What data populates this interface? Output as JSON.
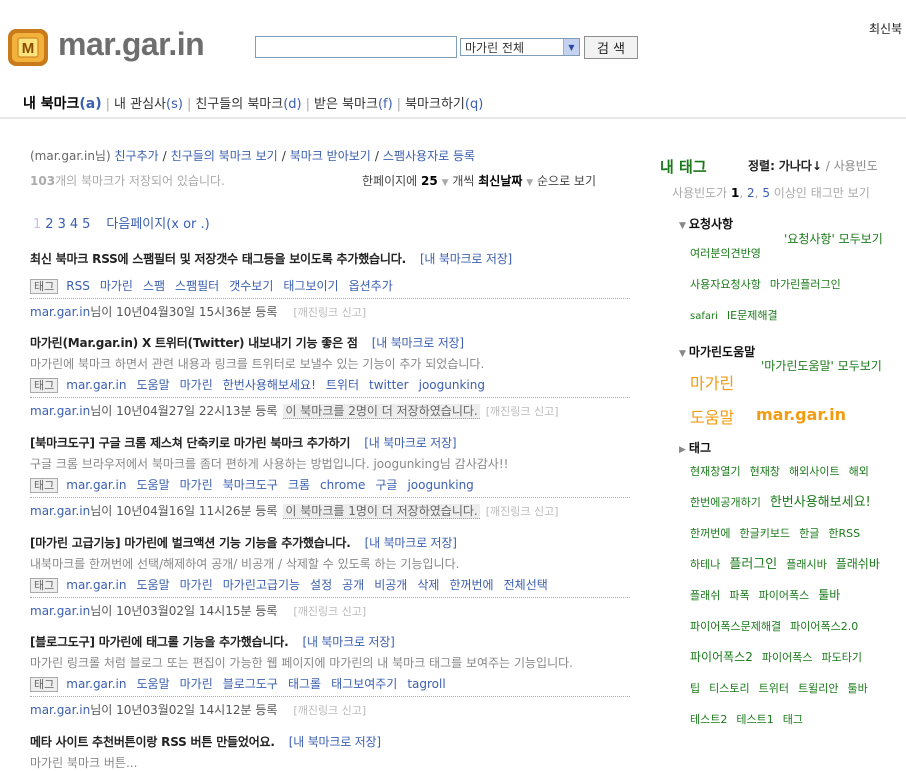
{
  "header": {
    "logo_letter": "M",
    "site_name": "mar.gar.in",
    "search_placeholder": "",
    "scope_selected": "마가린 전체",
    "search_button": "검 색",
    "top_right_link": "최신북"
  },
  "tabs": [
    {
      "label": "내 북마크",
      "key": "(a)",
      "active": true
    },
    {
      "label": "내 관심사",
      "key": "(s)"
    },
    {
      "label": "친구들의 북마크",
      "key": "(d)"
    },
    {
      "label": "받은 북마크",
      "key": "(f)"
    },
    {
      "label": "북마크하기",
      "key": "(q)"
    }
  ],
  "user_actions": {
    "owner": "(mar.gar.in님)",
    "links": [
      "친구추가",
      "친구들의 북마크 보기",
      "북마크 받아보기",
      "스팸사용자로 등록"
    ]
  },
  "count_line": {
    "count": "103",
    "text": "개의 북마크가 저장되어 있습니다."
  },
  "per_page": {
    "prefix": "한페이지에",
    "count": "25",
    "unit": "개씩",
    "sort": "최신날짜",
    "suffix": "순으로 보기"
  },
  "pager": {
    "current": "1",
    "pages": [
      "2",
      "3",
      "4",
      "5"
    ],
    "next": "다음페이지(x or .)"
  },
  "save_label": "[내 북마크로 저장]",
  "tag_box": "태그",
  "report_label": "[깨진링크 신고]",
  "entries": [
    {
      "title": "최신 북마크 RSS에 스팸필터 및 저장갯수 태그등을 보이도록 추가했습니다.",
      "desc": "",
      "tags": [
        "RSS",
        "마가린",
        "스팸",
        "스팸필터",
        "갯수보기",
        "태그보이기",
        "옵션추가"
      ],
      "meta_src": "mar.gar.in",
      "meta_text": "님이 10년04월30일 15시36분 등록",
      "more": ""
    },
    {
      "title": "마가린(Mar.gar.in) X 트위터(Twitter) 내보내기 기능 좋은 점",
      "desc": "마가린에 북마크 하면서 관련 내용과 링크를 트위터로 보낼수 있는 기능이 추가 되었습니다.",
      "tags": [
        "mar.gar.in",
        "도움말",
        "마가린",
        "한번사용해보세요!",
        "트위터",
        "twitter",
        "joogunking"
      ],
      "meta_src": "mar.gar.in",
      "meta_text": "님이 10년04월27일 22시13분 등록",
      "more": "이 북마크를 2명이 더 저장하였습니다."
    },
    {
      "title": "[북마크도구] 구글 크롬 제스쳐 단축키로 마가린 북마크 추가하기",
      "desc": "구글 크롬 브라우저에서 북마크를 좀더 편하게 사용하는 방법입니다. joogunking님 감사감사!!",
      "tags": [
        "mar.gar.in",
        "도움말",
        "마가린",
        "북마크도구",
        "크롬",
        "chrome",
        "구글",
        "joogunking"
      ],
      "meta_src": "mar.gar.in",
      "meta_text": "님이 10년04월16일 11시26분 등록",
      "more": "이 북마크를 1명이 더 저장하였습니다."
    },
    {
      "title": "[마가린 고급기능] 마가린에 벌크액션 기능 기능을 추가했습니다.",
      "desc": "내북마크를 한꺼번에 선택/해제하여 공개/ 비공개 / 삭제할 수 있도록 하는 기능입니다.",
      "tags": [
        "mar.gar.in",
        "도움말",
        "마가린",
        "마가린고급기능",
        "설정",
        "공개",
        "비공개",
        "삭제",
        "한꺼번에",
        "전체선택"
      ],
      "meta_src": "mar.gar.in",
      "meta_text": "님이 10년03월02일 14시15분 등록",
      "more": ""
    },
    {
      "title": "[블로그도구] 마가린에 태그롤 기능을 추가했습니다.",
      "desc": "마가린 링크롤 처럼 블로그 또는 편집이 가능한 웹 페이지에 마가린의 내 북마크 태그를 보여주는 기능입니다.",
      "tags": [
        "mar.gar.in",
        "도움말",
        "마가린",
        "블로그도구",
        "태그롤",
        "태그보여주기",
        "tagroll"
      ],
      "meta_src": "mar.gar.in",
      "meta_text": "님이 10년03월02일 14시12분 등록",
      "more": ""
    },
    {
      "title": "메타 사이트 추천버튼이랑 RSS 버튼 만들었어요.",
      "desc": "마가린 북마크 버튼...",
      "tags": [],
      "meta_src": "",
      "meta_text": "",
      "more": ""
    }
  ],
  "sidebar": {
    "title": "내 태그",
    "sort_label": "정렬:",
    "sort_active": "가나다↓",
    "sort_alt": "사용빈도",
    "filter": {
      "prefix": "사용빈도가",
      "n1": "1",
      "n2": "2",
      "n3": "5",
      "suffix": "이상인 태그만 보기"
    },
    "sections": [
      {
        "name": "요청사항",
        "more": "'요청사항' 모두보기",
        "tags": [
          "여러분의견반영",
          "사용자요청사항",
          "마가린플러그인",
          "safari",
          "IE문제해결"
        ]
      },
      {
        "name": "마가린도움말",
        "more": "'마가린도움말' 모두보기",
        "tags": [
          "마가린",
          "도움말",
          "mar.gar.in"
        ]
      },
      {
        "name": "태그",
        "more": "",
        "tags": [
          "현재창열기",
          "현재창",
          "해외사이트",
          "해외",
          "한번에공개하기",
          "한번사용해보세요!",
          "한꺼번에",
          "한글키보드",
          "한글",
          "한RSS",
          "하테나",
          "플러그인",
          "플래시바",
          "플래쉬바",
          "플래쉬",
          "파폭",
          "파이어폭스",
          "툴바",
          "파이어폭스문제해결",
          "파이어폭스2.0",
          "파이어폭스2",
          "파이어폭스",
          "파도타기",
          "팁",
          "티스토리",
          "트위터",
          "트윌리안",
          "툴바",
          "테스트2",
          "테스트1",
          "태그"
        ]
      }
    ]
  },
  "colors": {
    "link": "#3b5fb0",
    "tag_green": "#1a7a1a",
    "orange": "#f39c12",
    "site_name": "#6e6e6e"
  }
}
